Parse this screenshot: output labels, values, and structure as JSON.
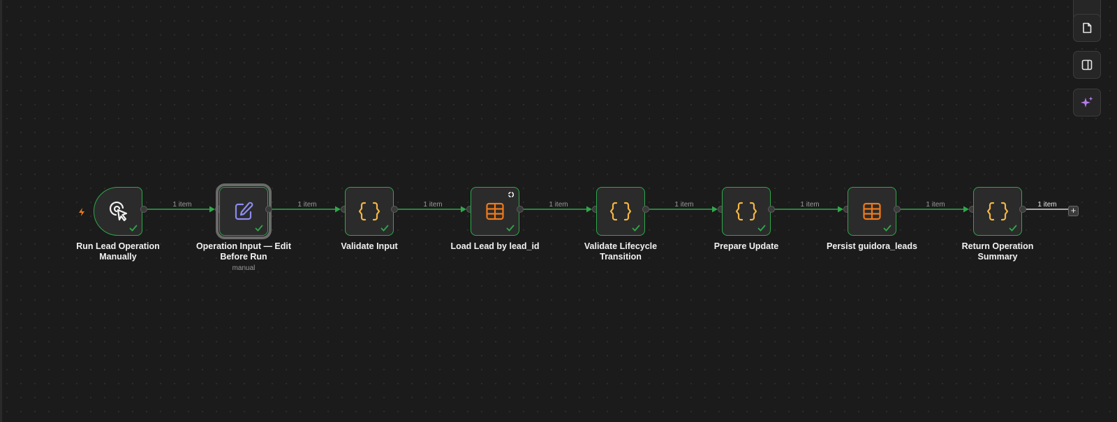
{
  "canvas": {
    "colors": {
      "background": "#1b1b1b",
      "success": "#2ea84a",
      "code_icon": "#f5b642",
      "table_icon": "#f07a1a",
      "form_icon": "#8c8cf0",
      "ai_icon": "#b57bf0"
    }
  },
  "nodes": [
    {
      "title": "Run Lead Operation Manually",
      "icon": "cursor-click-icon",
      "status": "success"
    },
    {
      "title": "Operation Input — Edit Before Run",
      "subtitle": "manual",
      "icon": "pen-square-icon",
      "status": "success",
      "selected": true
    },
    {
      "title": "Validate Input",
      "icon": "code-braces-icon",
      "status": "success"
    },
    {
      "title": "Load Lead by lead_id",
      "icon": "table-icon",
      "status": "success"
    },
    {
      "title": "Validate Lifecycle Transition",
      "icon": "code-braces-icon",
      "status": "success"
    },
    {
      "title": "Prepare Update",
      "icon": "code-braces-icon",
      "status": "success"
    },
    {
      "title": "Persist guidora_leads",
      "icon": "table-icon",
      "status": "success"
    },
    {
      "title": "Return Operation Summary",
      "icon": "code-braces-icon",
      "status": "success"
    }
  ],
  "edges": [
    {
      "label": "1 item"
    },
    {
      "label": "1 item"
    },
    {
      "label": "1 item"
    },
    {
      "label": "1 item"
    },
    {
      "label": "1 item"
    },
    {
      "label": "1 item"
    },
    {
      "label": "1 item"
    },
    {
      "label": "1 item"
    }
  ],
  "add_node": {
    "label": "+"
  },
  "side_toolbar": [
    {
      "name": "sticky-note-button",
      "icon": "sticky-note-icon"
    },
    {
      "name": "panel-toggle-button",
      "icon": "panel-right-icon"
    },
    {
      "name": "ai-assistant-button",
      "icon": "sparkles-icon"
    }
  ]
}
